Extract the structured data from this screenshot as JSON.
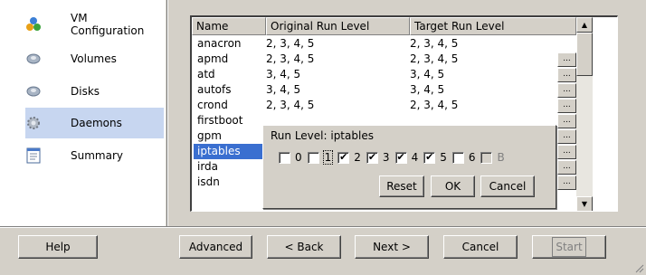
{
  "sidebar": {
    "items": [
      {
        "label": "VM Configuration",
        "icon": "vm-configuration-icon"
      },
      {
        "label": "Volumes",
        "icon": "volume-icon"
      },
      {
        "label": "Disks",
        "icon": "disk-icon"
      },
      {
        "label": "Daemons",
        "icon": "daemon-gear-icon",
        "active": true
      },
      {
        "label": "Summary",
        "icon": "summary-document-icon"
      }
    ]
  },
  "grid": {
    "headers": [
      "Name",
      "Original Run Level",
      "Target Run Level"
    ],
    "rows": [
      {
        "name": "anacron",
        "original": "2, 3, 4, 5",
        "target": "2, 3, 4, 5"
      },
      {
        "name": "apmd",
        "original": "2, 3, 4, 5",
        "target": "2, 3, 4, 5"
      },
      {
        "name": "atd",
        "original": "3, 4, 5",
        "target": "3, 4, 5"
      },
      {
        "name": "autofs",
        "original": "3, 4, 5",
        "target": "3, 4, 5"
      },
      {
        "name": "crond",
        "original": "2, 3, 4, 5",
        "target": "2, 3, 4, 5"
      },
      {
        "name": "firstboot",
        "original": "",
        "target": ""
      },
      {
        "name": "gpm",
        "original": "",
        "target": ""
      },
      {
        "name": "iptables",
        "original": "",
        "target": "",
        "selected": true
      },
      {
        "name": "irda",
        "original": "",
        "target": ""
      },
      {
        "name": "isdn",
        "original": "",
        "target": ""
      }
    ],
    "ellipsis_label": "..."
  },
  "runlevel_popup": {
    "title": "Run Level: iptables",
    "levels": [
      {
        "label": "0",
        "checked": false
      },
      {
        "label": "1",
        "checked": false,
        "focused": true
      },
      {
        "label": "2",
        "checked": true
      },
      {
        "label": "3",
        "checked": true
      },
      {
        "label": "4",
        "checked": true
      },
      {
        "label": "5",
        "checked": true
      },
      {
        "label": "6",
        "checked": false
      },
      {
        "label": "B",
        "checked": false,
        "disabled": true
      }
    ],
    "reset_label": "Reset",
    "ok_label": "OK",
    "cancel_label": "Cancel"
  },
  "footer": {
    "help_label": "Help",
    "advanced_label": "Advanced",
    "back_label": "< Back",
    "next_label": "Next >",
    "cancel_label": "Cancel",
    "start_label": "Start"
  },
  "colors": {
    "face": "#d4d0c8",
    "selection": "#3a6fd0",
    "active_nav": "#c7d6f0"
  }
}
